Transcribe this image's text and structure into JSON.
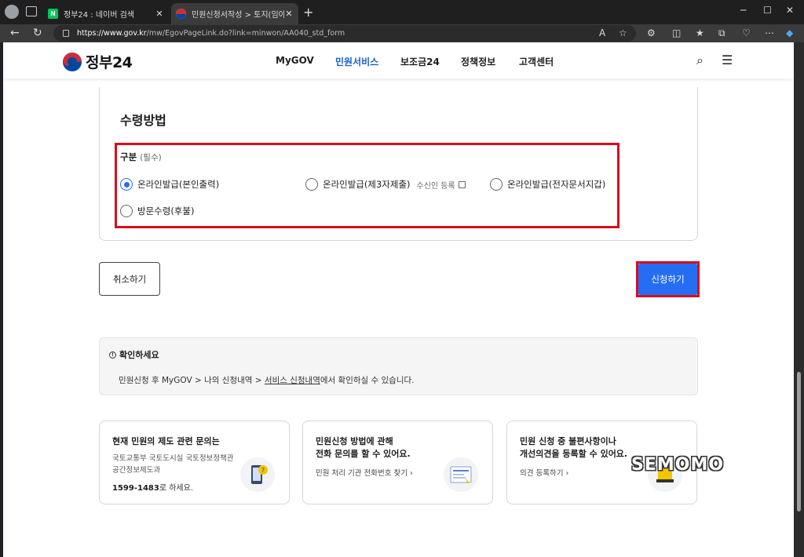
{
  "browser": {
    "tabs": [
      {
        "title": "정부24 : 네이버 검색",
        "favicon": "N"
      },
      {
        "title": "민원신청서작성 > 토지(임야)대장"
      }
    ],
    "url_host": "https://www.gov.kr",
    "url_path": "/mw/EgovPageLink.do?link=minwon/AA040_std_form"
  },
  "header": {
    "logo": "정부24",
    "nav": [
      "MyGOV",
      "민원서비스",
      "보조금24",
      "정책정보",
      "고객센터"
    ],
    "active_nav": "민원서비스"
  },
  "receipt": {
    "title": "수령방법",
    "field_label": "구분",
    "required": "(필수)",
    "options": [
      {
        "label": "온라인발급(본인출력)",
        "selected": true
      },
      {
        "label": "온라인발급(제3자제출)",
        "sub": "수신인 등록",
        "selected": false
      },
      {
        "label": "온라인발급(전자문서지갑)",
        "selected": false
      },
      {
        "label": "방문수령(후불)",
        "selected": false
      }
    ]
  },
  "actions": {
    "cancel": "취소하기",
    "apply": "신청하기"
  },
  "notice": {
    "title": "확인하세요",
    "body_pre": "민원신청 후 MyGOV > 나의 신청내역 > ",
    "body_link": "서비스 신청내역",
    "body_post": "에서 확인하실 수 있습니다."
  },
  "help_cards": [
    {
      "title": "현재 민원의 제도 관련 문의는",
      "desc1": "국토교통부 국토도시실 국토정보정책관",
      "desc2": "공간정보제도과",
      "phone": "1599-1483",
      "phone_suffix": "로 하세요."
    },
    {
      "title1": "민원신청 방법에 관해",
      "title2": "전화 문의를 할 수 있어요.",
      "link": "민원 처리 기관 전화번호 찾기"
    },
    {
      "title1": "민원 신청 중 불편사항이나",
      "title2": "개선의견을 등록할 수 있어요.",
      "link": "의견 등록하기"
    }
  ],
  "watermark": "SEMOMO",
  "colors": {
    "primary": "#256ef4",
    "highlight": "#d50d1f",
    "active_nav": "#1a5fc9"
  }
}
